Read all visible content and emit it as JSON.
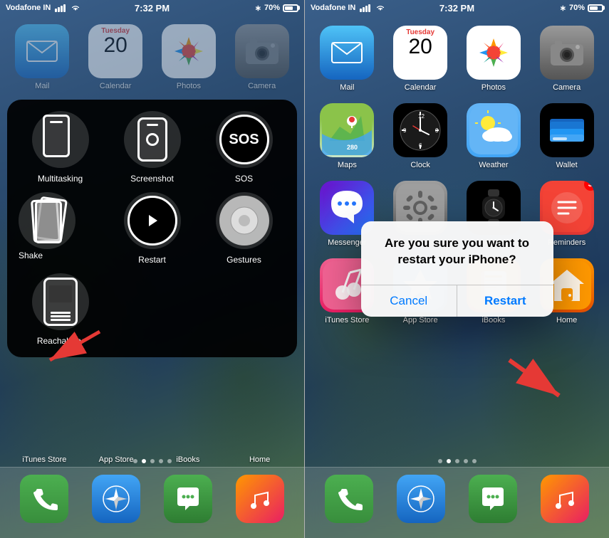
{
  "left_phone": {
    "status_bar": {
      "carrier": "Vodafone IN",
      "time": "7:32 PM",
      "battery": "70%"
    },
    "top_apps": [
      {
        "label": "Mail",
        "icon": "mail"
      },
      {
        "label": "Calendar",
        "icon": "calendar",
        "date_num": "20",
        "day": "Tuesday"
      },
      {
        "label": "Photos",
        "icon": "photos"
      },
      {
        "label": "Camera",
        "icon": "camera"
      }
    ],
    "assistive_touch": {
      "items": [
        {
          "id": "multitasking",
          "label": "Multitasking"
        },
        {
          "id": "screenshot",
          "label": "Screenshot"
        },
        {
          "id": "sos",
          "label": "SOS"
        },
        {
          "id": "shake",
          "label": "Shake"
        },
        {
          "id": "restart",
          "label": "Restart"
        },
        {
          "id": "gestures",
          "label": "Gestures"
        },
        {
          "id": "reachability",
          "label": "Reachability"
        }
      ]
    },
    "bottom_labels": [
      "iTunes Store",
      "App Store",
      "iBooks",
      "Home"
    ],
    "dock": [
      {
        "label": "Phone",
        "icon": "phone"
      },
      {
        "label": "Safari",
        "icon": "safari"
      },
      {
        "label": "Messages",
        "icon": "messages"
      },
      {
        "label": "Music",
        "icon": "music"
      }
    ]
  },
  "right_phone": {
    "status_bar": {
      "carrier": "Vodafone IN",
      "time": "7:32 PM",
      "battery": "70%"
    },
    "top_apps": [
      {
        "label": "Mail",
        "icon": "mail"
      },
      {
        "label": "Calendar",
        "icon": "calendar",
        "date_num": "20",
        "day": "Tuesday"
      },
      {
        "label": "Photos",
        "icon": "photos"
      },
      {
        "label": "Camera",
        "icon": "camera"
      }
    ],
    "second_row": [
      {
        "label": "Maps",
        "icon": "maps"
      },
      {
        "label": "Clock",
        "icon": "clock"
      },
      {
        "label": "Weather",
        "icon": "weather"
      },
      {
        "label": "Wallet",
        "icon": "wallet"
      }
    ],
    "third_row": [
      {
        "label": "Messenger",
        "icon": "messenger"
      },
      {
        "label": "Settings",
        "icon": "settings"
      },
      {
        "label": "Watch",
        "icon": "watch"
      },
      {
        "label": "Reminders",
        "icon": "reminders",
        "badge": "3"
      }
    ],
    "fourth_row": [
      {
        "label": "iTunes Store",
        "icon": "itunes"
      },
      {
        "label": "App Store",
        "icon": "appstore"
      },
      {
        "label": "iBooks",
        "icon": "ibooks"
      },
      {
        "label": "Home",
        "icon": "home"
      }
    ],
    "dialog": {
      "title": "Are you sure you want to restart your iPhone?",
      "cancel_label": "Cancel",
      "restart_label": "Restart"
    },
    "dock": [
      {
        "label": "Phone",
        "icon": "phone"
      },
      {
        "label": "Safari",
        "icon": "safari"
      },
      {
        "label": "Messages",
        "icon": "messages"
      },
      {
        "label": "Music",
        "icon": "music"
      }
    ]
  }
}
